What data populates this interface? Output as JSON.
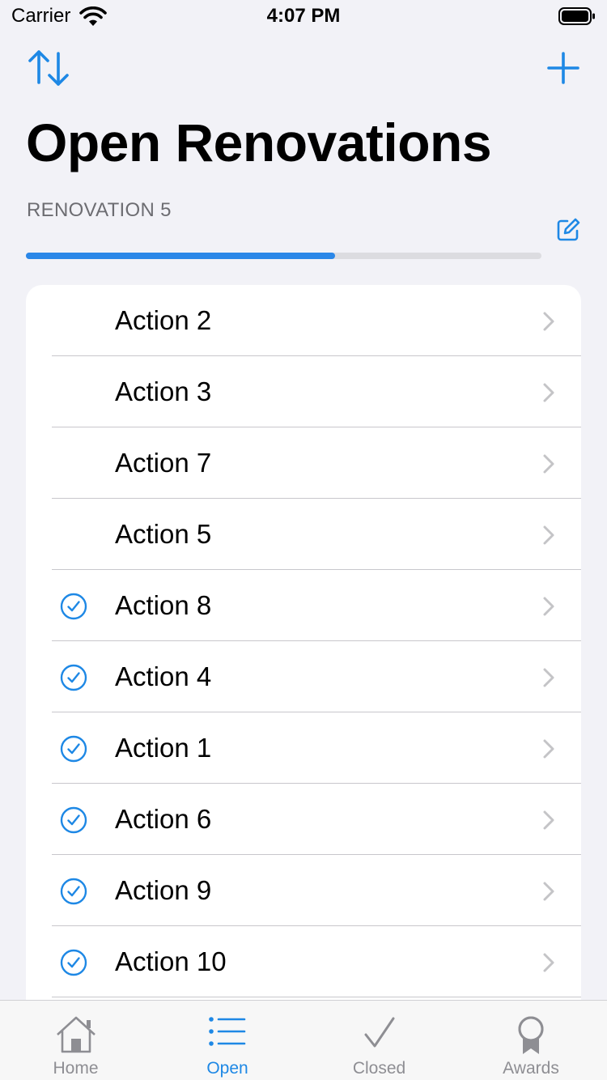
{
  "status_bar": {
    "carrier": "Carrier",
    "time": "4:07 PM"
  },
  "nav": {
    "title": "Open Renovations",
    "sort_icon": "sort-arrows-icon",
    "add_icon": "plus-icon"
  },
  "section": {
    "title": "RENOVATION 5",
    "edit_icon": "edit-square-icon",
    "progress": 0.6
  },
  "actions": [
    {
      "label": "Action 2",
      "completed": false
    },
    {
      "label": "Action 3",
      "completed": false
    },
    {
      "label": "Action 7",
      "completed": false
    },
    {
      "label": "Action 5",
      "completed": false
    },
    {
      "label": "Action 8",
      "completed": true
    },
    {
      "label": "Action 4",
      "completed": true
    },
    {
      "label": "Action 1",
      "completed": true
    },
    {
      "label": "Action 6",
      "completed": true
    },
    {
      "label": "Action 9",
      "completed": true
    },
    {
      "label": "Action 10",
      "completed": true
    }
  ],
  "tabs": [
    {
      "label": "Home",
      "icon": "house-icon",
      "active": false
    },
    {
      "label": "Open",
      "icon": "list-icon",
      "active": true
    },
    {
      "label": "Closed",
      "icon": "checkmark-icon",
      "active": false
    },
    {
      "label": "Awards",
      "icon": "award-ribbon-icon",
      "active": false
    }
  ],
  "colors": {
    "accent": "#2B87E8",
    "background": "#F2F2F7",
    "secondary_text": "#6D6D72"
  }
}
